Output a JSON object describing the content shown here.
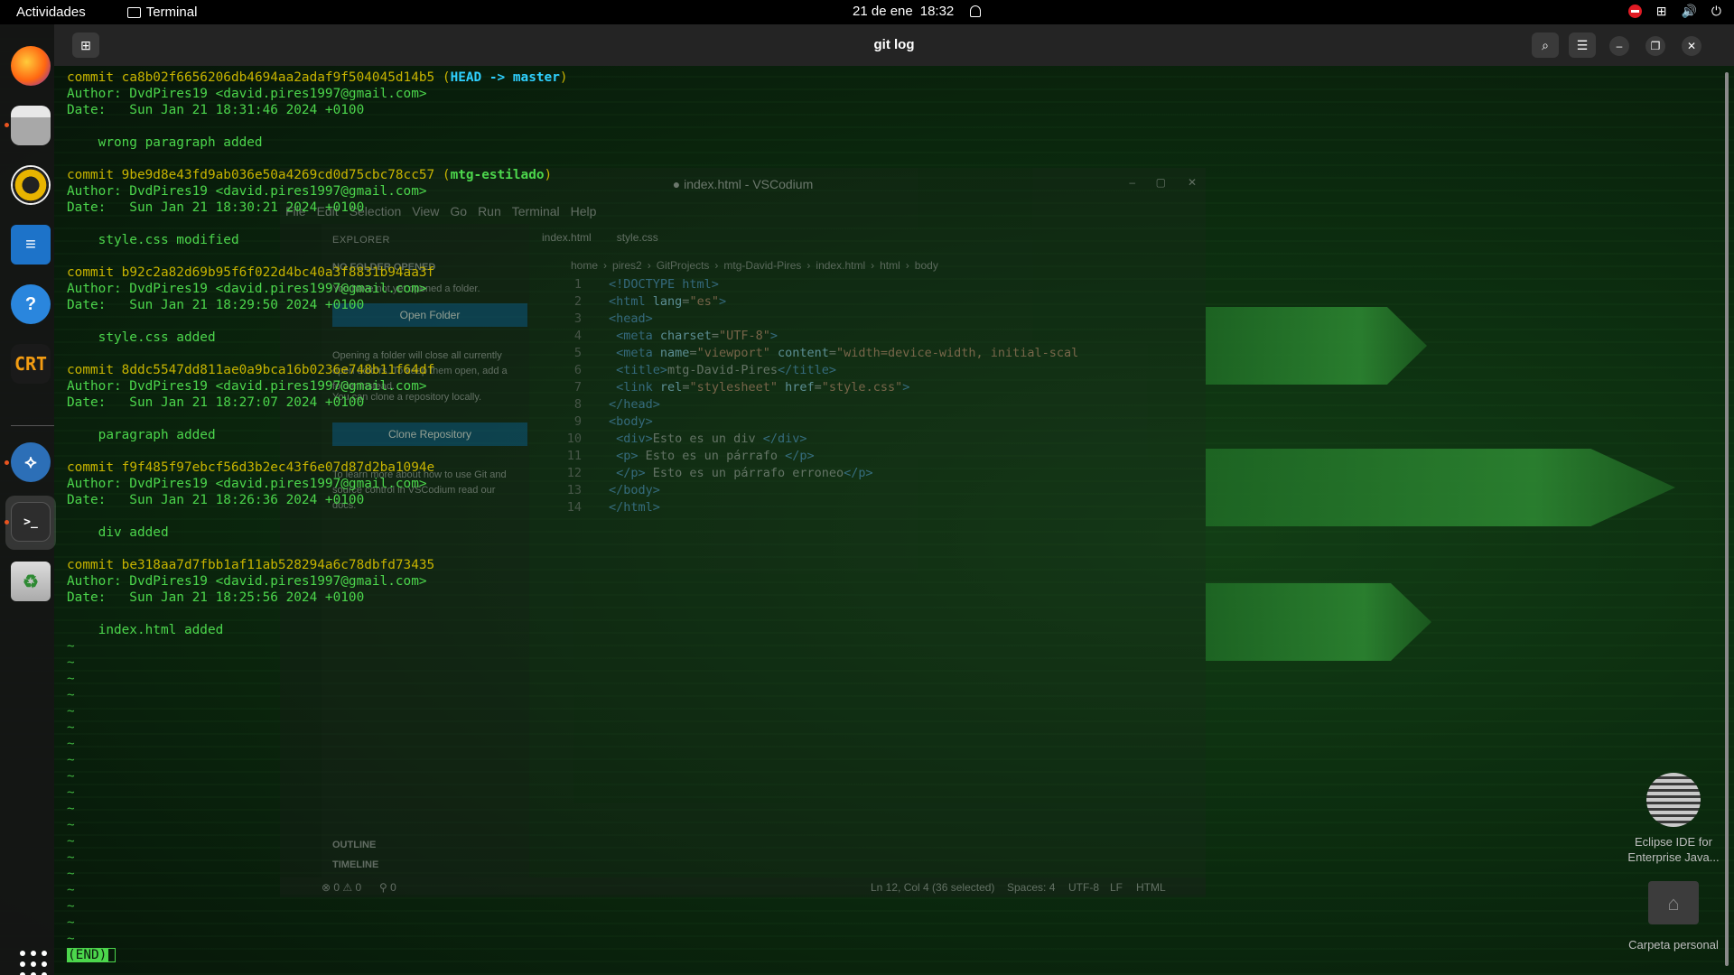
{
  "topbar": {
    "activities": "Actividades",
    "app_name": "Terminal",
    "date": "21 de ene",
    "time": "18:32"
  },
  "dock": {
    "items": [
      "firefox-icon",
      "files-icon",
      "rhythmbox-icon",
      "writer-icon",
      "help-icon",
      "cool-retro-term-icon",
      "vscodium-icon",
      "terminal-icon",
      "trash-icon"
    ],
    "crt_label": "CRT"
  },
  "terminal": {
    "title": "git log",
    "commits": [
      {
        "hash": "ca8b02f6656206db4694aa2adaf9f504045d14b5",
        "refs_head": "HEAD -> master",
        "author": "Author: DvdPires19 <david.pires1997@gmail.com>",
        "date": "Date:   Sun Jan 21 18:31:46 2024 +0100",
        "message": "    wrong paragraph added"
      },
      {
        "hash": "9be9d8e43fd9ab036e50a4269cd0d75cbc78cc57",
        "refs_branch": "mtg-estilado",
        "author": "Author: DvdPires19 <david.pires1997@gmail.com>",
        "date": "Date:   Sun Jan 21 18:30:21 2024 +0100",
        "message": "    style.css modified"
      },
      {
        "hash": "b92c2a82d69b95f6f022d4bc40a3f8831b94aa3f",
        "author": "Author: DvdPires19 <david.pires1997@gmail.com>",
        "date": "Date:   Sun Jan 21 18:29:50 2024 +0100",
        "message": "    style.css added"
      },
      {
        "hash": "8ddc5547dd811ae0a9bca16b0236e748b11f64df",
        "author": "Author: DvdPires19 <david.pires1997@gmail.com>",
        "date": "Date:   Sun Jan 21 18:27:07 2024 +0100",
        "message": "    paragraph added"
      },
      {
        "hash": "f9f485f97ebcf56d3b2ec43f6e07d87d2ba1094e",
        "author": "Author: DvdPires19 <david.pires1997@gmail.com>",
        "date": "Date:   Sun Jan 21 18:26:36 2024 +0100",
        "message": "    div added"
      },
      {
        "hash": "be318aa7d7fbb1af11ab528294a6c78dbfd73435",
        "author": "Author: DvdPires19 <david.pires1997@gmail.com>",
        "date": "Date:   Sun Jan 21 18:25:56 2024 +0100",
        "message": "    index.html added"
      }
    ],
    "commit_word": "commit",
    "tilde": "~",
    "end_marker": "(END)"
  },
  "vscodium": {
    "title": "● index.html - VSCodium",
    "menu": [
      "File",
      "Edit",
      "Selection",
      "View",
      "Go",
      "Run",
      "Terminal",
      "Help"
    ],
    "explorer_header": "EXPLORER",
    "no_folder": "NO FOLDER OPENED",
    "p1": "You have not yet opened a folder.",
    "open_folder": "Open Folder",
    "p2": "Opening a folder will close all currently open editors. To keep them open, add a folder instead.",
    "p3": "You can clone a repository locally.",
    "clone": "Clone Repository",
    "p4": "To learn more about how to use Git and source control in VSCodium read our docs.",
    "outline": "OUTLINE",
    "timeline": "TIMELINE",
    "tab1": "index.html",
    "tab2": "style.css",
    "breadcrumbs": [
      "home",
      "pires2",
      "GitProjects",
      "mtg-David-Pires",
      "index.html",
      "html",
      "body"
    ],
    "status": {
      "problems": "⊗ 0 ⚠ 0",
      "ports": "⚲ 0",
      "position": "Ln 12, Col 4 (36 selected)",
      "spaces": "Spaces: 4",
      "encoding": "UTF-8",
      "eol": "LF",
      "lang": "HTML"
    }
  },
  "desktop": {
    "eclipse": "Eclipse IDE for Enterprise Java...",
    "home": "Carpeta personal"
  }
}
